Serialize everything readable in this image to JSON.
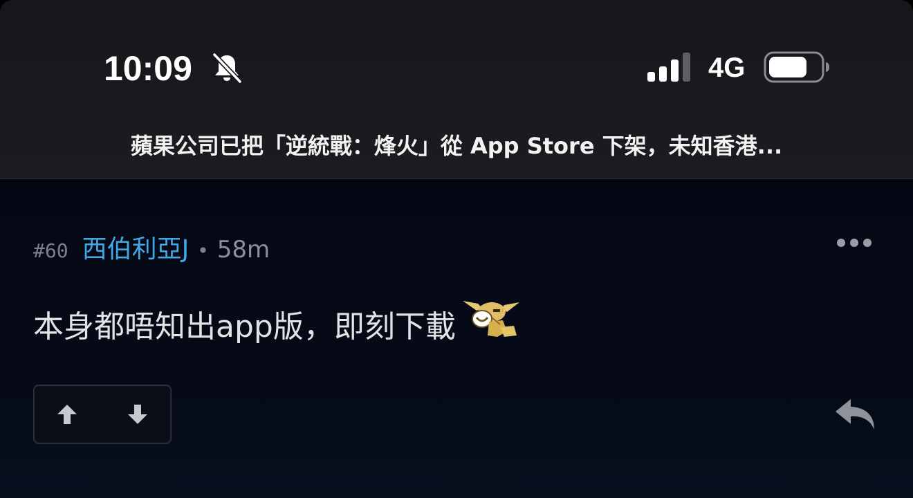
{
  "status_bar": {
    "time": "10:09",
    "silent_icon": "bell-slash-icon",
    "signal_icon": "cellular-signal-icon",
    "network": "4G",
    "battery_icon": "battery-icon"
  },
  "header": {
    "thread_title": "蘋果公司已把「逆統戰：烽火」從 App Store 下架，未知香港..."
  },
  "post": {
    "floor": "#60",
    "username": "西伯利亞J",
    "separator": "•",
    "time": "58m",
    "more_icon": "more-dots-icon",
    "content": "本身都唔知出app版，即刻下載",
    "emoji_icon": "laughing-creature-emoji-icon",
    "upvote_icon": "arrow-up-icon",
    "downvote_icon": "arrow-down-icon",
    "reply_icon": "reply-arrow-icon"
  },
  "colors": {
    "username": "#40a9e8",
    "background": "#050814",
    "header_background": "#1b1c20"
  }
}
